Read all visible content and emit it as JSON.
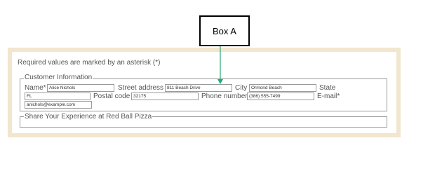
{
  "callout": {
    "label": "Box A"
  },
  "form": {
    "required_note": "Required values are marked by an asterisk (*)",
    "customer_legend": "Customer Information",
    "share_legend": "Share Your Experience at Red Ball Pizza",
    "fields": {
      "name": {
        "label": "Name*",
        "value": "Alice Nichols"
      },
      "street": {
        "label": "Street address",
        "value": "811 Beach Drive"
      },
      "city": {
        "label": "City",
        "value": "Ormond Beach"
      },
      "state": {
        "label": "State",
        "value": "FL"
      },
      "postal": {
        "label": "Postal code",
        "value": "32175"
      },
      "phone": {
        "label": "Phone number",
        "value": "(386) 555-7499"
      },
      "email": {
        "label": "E-mail*",
        "value": "anichols@example.com"
      }
    }
  },
  "colors": {
    "arrow": "#2aa876",
    "frame": "#f1e6ce"
  }
}
